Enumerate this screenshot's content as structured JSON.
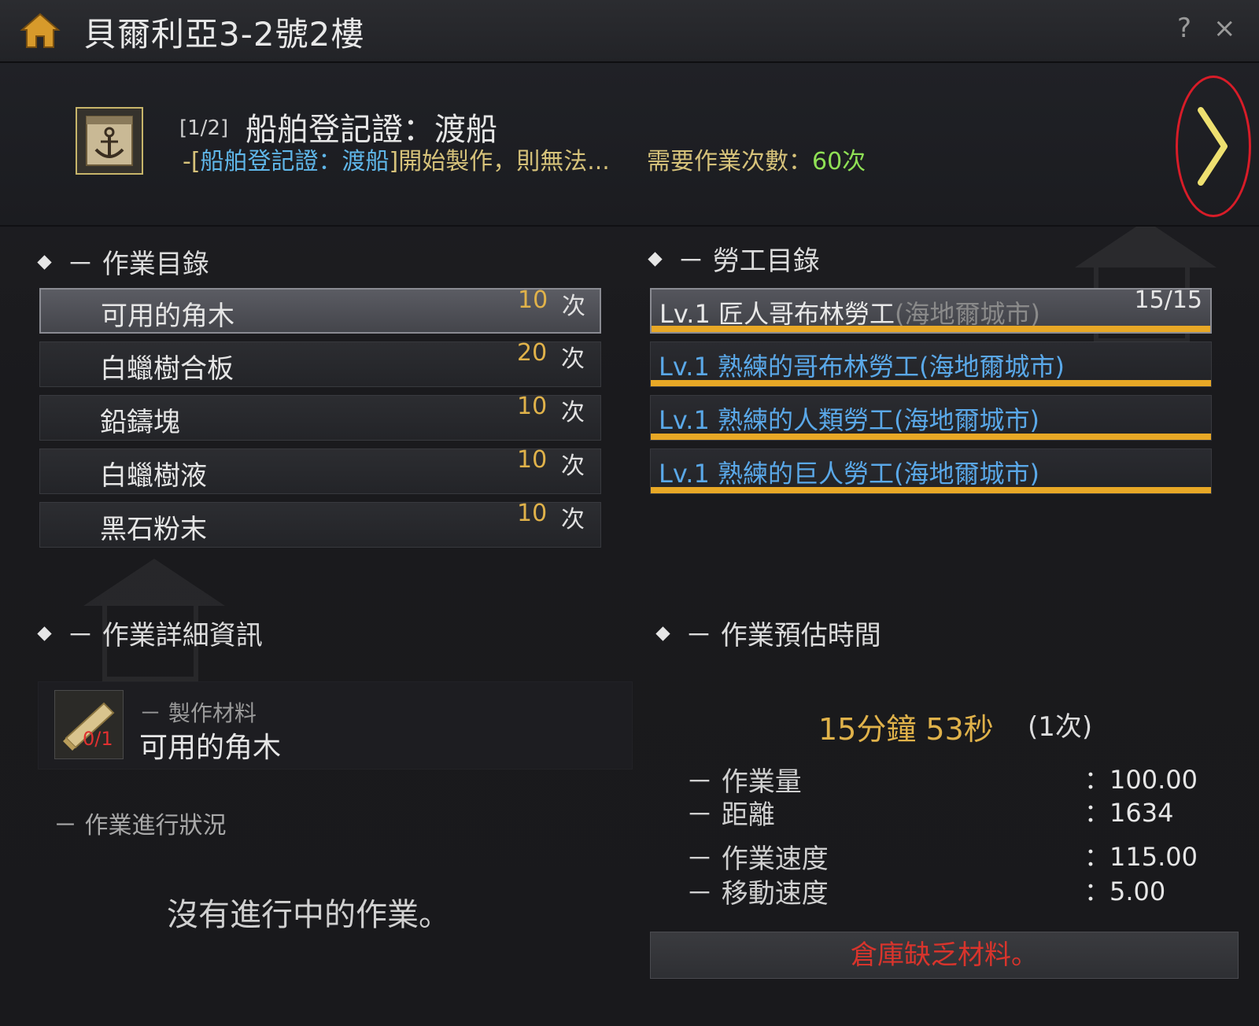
{
  "window": {
    "title": "貝爾利亞3-2號2樓",
    "help_label": "?",
    "close_label": "×"
  },
  "header": {
    "counter": "[1/2]",
    "item_name": "船舶登記證：渡船",
    "desc_lead": "-[",
    "desc_link": "船舶登記證：渡船",
    "desc_rest": "]開始製作，則無法...",
    "required_label": "需要作業次數：",
    "required_value": "60次",
    "next_label": "〉"
  },
  "work_list": {
    "title": "－ 作業目錄",
    "unit": "次",
    "items": [
      {
        "name": "可用的角木",
        "count": "10"
      },
      {
        "name": "白蠟樹合板",
        "count": "20"
      },
      {
        "name": "鉛鑄塊",
        "count": "10"
      },
      {
        "name": "白蠟樹液",
        "count": "10"
      },
      {
        "name": "黑石粉末",
        "count": "10"
      }
    ]
  },
  "worker_list": {
    "title": "－ 勞工目錄",
    "stamina": "15/15",
    "items": [
      {
        "lv": "Lv.1",
        "name": "匠人哥布林勞工",
        "city": "(海地爾城市)"
      },
      {
        "lv": "Lv.1",
        "name": "熟練的哥布林勞工",
        "city": "(海地爾城市)"
      },
      {
        "lv": "Lv.1",
        "name": "熟練的人類勞工",
        "city": "(海地爾城市)"
      },
      {
        "lv": "Lv.1",
        "name": "熟練的巨人勞工",
        "city": "(海地爾城市)"
      }
    ]
  },
  "detail": {
    "title": "－ 作業詳細資訊",
    "material_label": "－ 製作材料",
    "material_name": "可用的角木",
    "material_qty": "0/1",
    "progress_label": "－ 作業進行狀況",
    "no_work": "沒有進行中的作業。"
  },
  "estimate": {
    "title": "－ 作業預估時間",
    "time": "15分鐘 53秒",
    "times": "(1次)",
    "stats": [
      {
        "label": "－ 作業量",
        "value": "：100.00"
      },
      {
        "label": "－ 距離",
        "value": "：1634"
      },
      {
        "label": "－ 作業速度",
        "value": "：115.00"
      },
      {
        "label": "－ 移動速度",
        "value": "：5.00"
      }
    ],
    "warning": "倉庫缺乏材料。"
  },
  "colors": {
    "accent_gold": "#e0b24a",
    "worker_blue": "#5aa8e8",
    "warn_red": "#d8342c",
    "bar_orange": "#e8a826"
  },
  "icons": [
    "home-icon",
    "anchor-icon",
    "wood-icon",
    "chevron-right-icon",
    "close-icon",
    "help-icon"
  ]
}
